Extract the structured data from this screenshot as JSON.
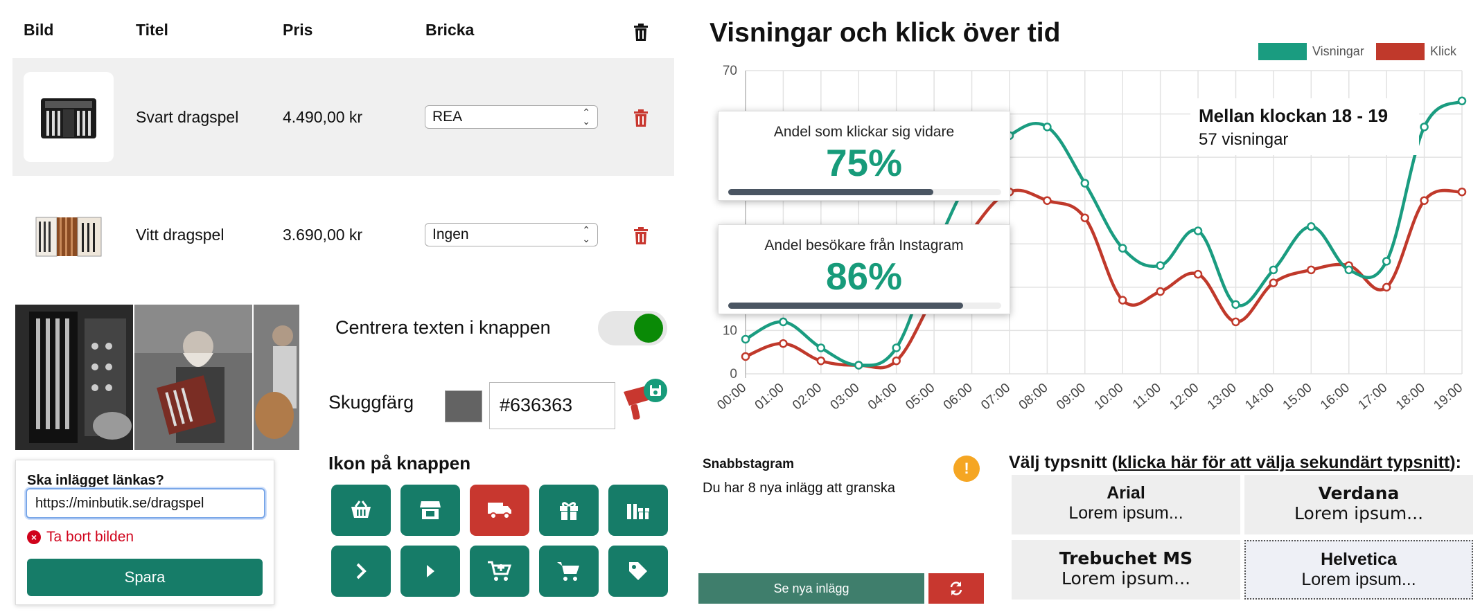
{
  "table": {
    "headers": {
      "image": "Bild",
      "title": "Titel",
      "price": "Pris",
      "badge": "Bricka"
    },
    "rows": [
      {
        "title": "Svart dragspel",
        "price": "4.490,00 kr",
        "badge": "REA"
      },
      {
        "title": "Vitt dragspel",
        "price": "3.690,00 kr",
        "badge": "Ingen"
      }
    ]
  },
  "image_editor": {
    "link_question": "Ska inlägget länkas?",
    "link_value": "https://minbutik.se/dragspel",
    "remove_label": "Ta bort bilden",
    "save_label": "Spara"
  },
  "settings": {
    "center_text_label": "Centrera texten i knappen",
    "center_text_on": true,
    "shadow_label": "Skuggfärg",
    "shadow_color": "#636363",
    "icon_label": "Ikon på knappen",
    "icons": [
      "basket-icon",
      "store-icon",
      "truck-icon",
      "gift-icon",
      "gifts-icon",
      "chevron-right-icon",
      "caret-right-icon",
      "cart-plus-icon",
      "cart-icon",
      "tag-icon"
    ],
    "selected_icon": "truck-icon"
  },
  "chart_data": {
    "type": "line",
    "title": "Visningar och klick över tid",
    "categories": [
      "00:00",
      "01:00",
      "02:00",
      "03:00",
      "04:00",
      "05:00",
      "06:00",
      "07:00",
      "08:00",
      "09:00",
      "10:00",
      "11:00",
      "12:00",
      "13:00",
      "14:00",
      "15:00",
      "16:00",
      "17:00",
      "18:00",
      "19:00"
    ],
    "series": [
      {
        "name": "Visningar",
        "color": "#1a9c80",
        "values": [
          8,
          12,
          6,
          2,
          6,
          28,
          46,
          55,
          57,
          44,
          29,
          25,
          33,
          16,
          24,
          34,
          24,
          26,
          57,
          63
        ]
      },
      {
        "name": "Klick",
        "color": "#c0392b",
        "values": [
          4,
          7,
          3,
          2,
          3,
          18,
          33,
          42,
          40,
          36,
          17,
          19,
          23,
          12,
          21,
          24,
          25,
          20,
          40,
          42
        ]
      }
    ],
    "ylim": [
      0,
      70
    ],
    "y_ticks": [
      "70",
      "10",
      "0"
    ],
    "grid": true,
    "legend": "top-right",
    "tooltip": {
      "title": "Mellan klockan 18 - 19",
      "text": "57 visningar"
    }
  },
  "kpis": [
    {
      "label": "Andel som klickar sig vidare",
      "value": "75%",
      "progress": 0.75
    },
    {
      "label": "Andel besökare från Instagram",
      "value": "86%",
      "progress": 0.86
    }
  ],
  "snabbstagram": {
    "title": "Snabbstagram",
    "text": "Du har 8 nya inlägg att granska",
    "button": "Se nya inlägg"
  },
  "fonts": {
    "heading_start": "Välj typsnitt (",
    "heading_link": "klicka här för att välja sekundärt typsnitt",
    "heading_end": "):",
    "sample": "Lorem ipsum...",
    "options": [
      "Arial",
      "Verdana",
      "Trebuchet MS",
      "Helvetica"
    ],
    "selected": "Helvetica"
  }
}
